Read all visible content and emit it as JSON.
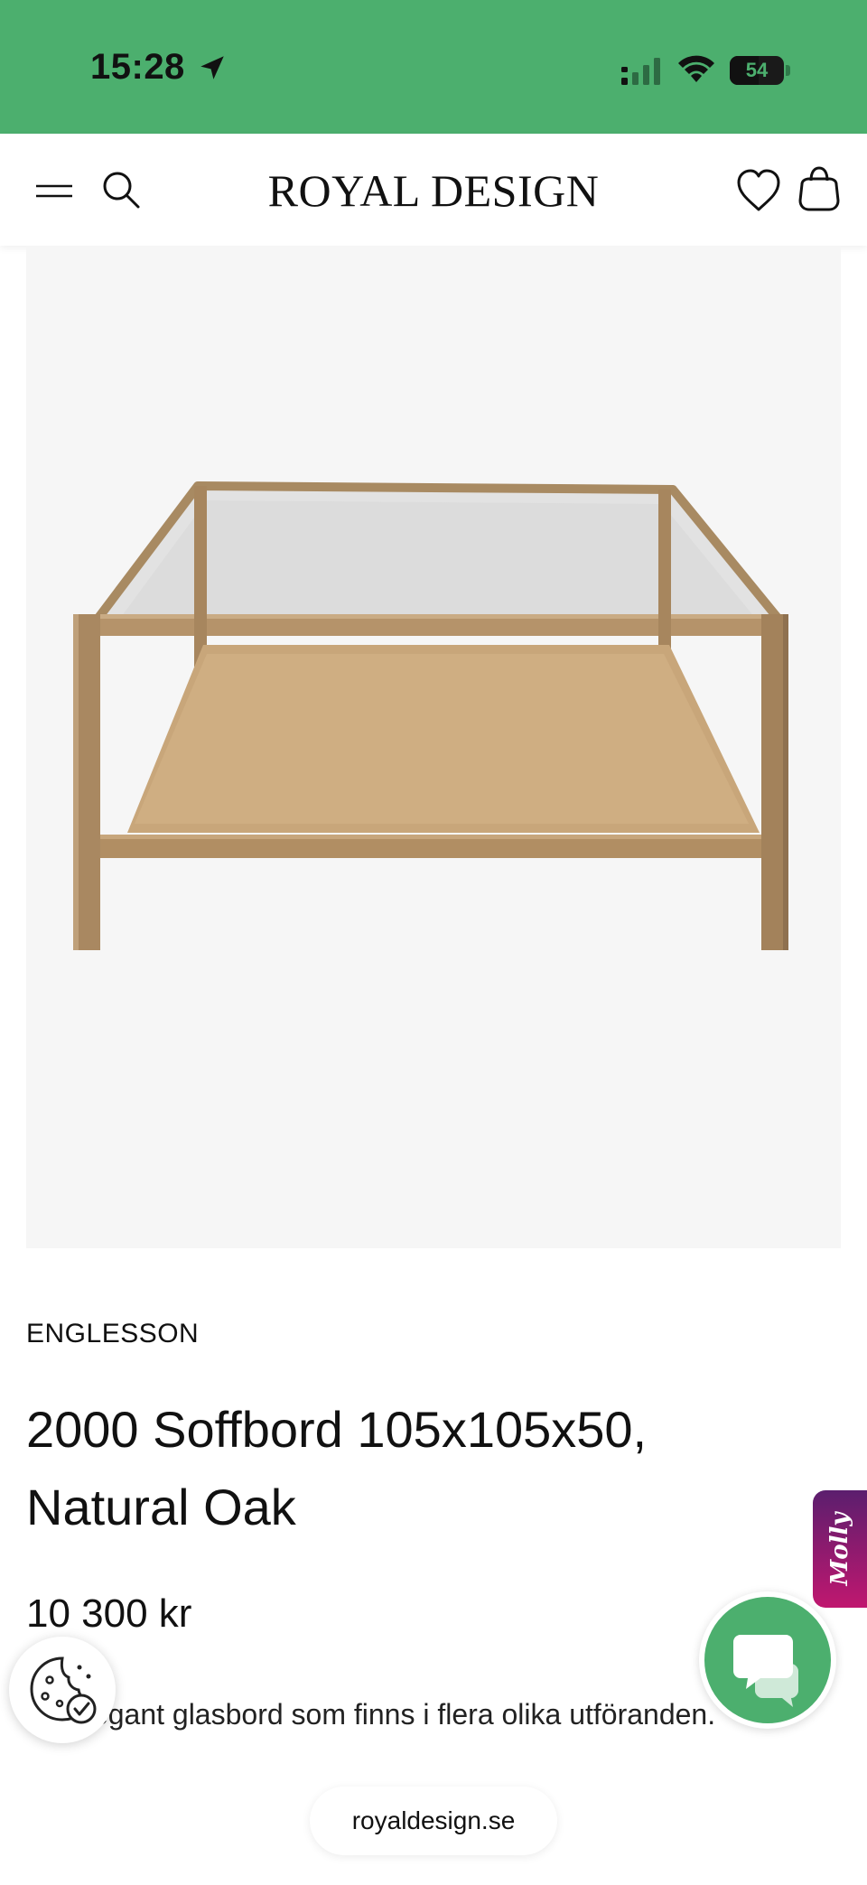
{
  "status_bar": {
    "time": "15:28",
    "battery_level": "54",
    "battery_fraction": 0.54,
    "background_color": "#4caf6e"
  },
  "header": {
    "logo": "ROYAL DESIGN",
    "icons": [
      "menu-icon",
      "search-icon",
      "heart-icon",
      "shopping-bag-icon"
    ]
  },
  "product": {
    "brand": "ENGLESSON",
    "title": "2000 Soffbord 105x105x50, Natural Oak",
    "price": "10 300 kr",
    "description": "Ett elegant glasbord som finns  i flera olika utföranden.",
    "image_icon": "glass-coffee-table-image"
  },
  "floating": {
    "cookie_icon": "cookie-settings-icon",
    "chat_icon": "chat-bubbles-icon",
    "chat_color": "#4caf6e",
    "molly_label": "Molly"
  },
  "browser": {
    "url": "royaldesign.se"
  }
}
